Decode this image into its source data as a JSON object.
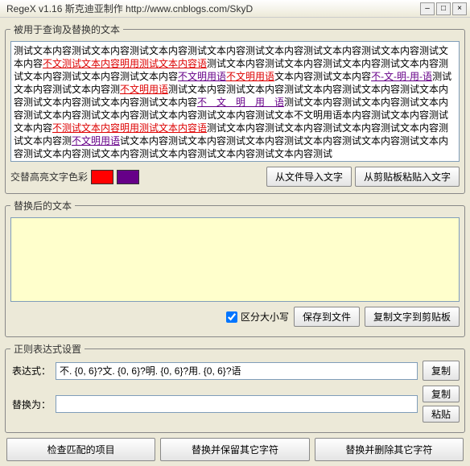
{
  "title": "RegeX v1.16  斯克迪亚制作   http://www.cnblogs.com/SkyD",
  "groups": {
    "source": "被用于查询及替换的文本",
    "replaced": "替换后的文本",
    "regex": "正则表达式设置"
  },
  "source_segments": [
    {
      "t": "测试文本内容测试文本内容测试文本内容测试文本内容测试文本内容测试文本内容测试文本内容测试文本内容",
      "c": "n"
    },
    {
      "t": "不文测试文本内容明用测试文本内容语",
      "c": "r"
    },
    {
      "t": "测试文本内容测试文本内容测试文本内容测试文本内容测试文本内容测试文本内容测试文本内容",
      "c": "n"
    },
    {
      "t": "不文明用语",
      "c": "p"
    },
    {
      "t": "不文明用语",
      "c": "r"
    },
    {
      "t": "文本内容测试文本内容",
      "c": "n"
    },
    {
      "t": "不-文-明-用-语",
      "c": "p"
    },
    {
      "t": "测试文本内容测试文本内容测",
      "c": "n"
    },
    {
      "t": "不文明用语",
      "c": "r"
    },
    {
      "t": "测试文本内容测试文本内容测试文本内容测试文本内容测试文本内容测试文本内容测试文本内容测试文本内容",
      "c": "n"
    },
    {
      "t": "不　文　明　用　语",
      "c": "p"
    },
    {
      "t": "测试文本内容测试文本内容测试文本内容测试文本内容测试文本内容测试文本内容测试文本内容测试文本不",
      "c": "n"
    },
    {
      "t": "文明用语本内容测试文本内容测试文本内容",
      "c": "n"
    },
    {
      "t": "不测试文本内容明用测试文本内容语",
      "c": "r"
    },
    {
      "t": "测试文本内容测试文本内容测试文本内容测试文本内容测试文本内容测",
      "c": "n"
    },
    {
      "t": "不文明用语",
      "c": "p"
    },
    {
      "t": "试文本内容测试文本内容测试文本内容测试文本内容测试文本内容测试文本内容测试文本内容测试文本内容测试文本内容测试文本内容测试文本内容测试",
      "c": "n"
    }
  ],
  "toolbar": {
    "swap_label": "交替高亮文字色彩",
    "import_file": "从文件导入文字",
    "paste_clip": "从剪贴板粘贴入文字"
  },
  "options": {
    "case_sensitive_label": "区分大小写",
    "case_sensitive": true,
    "save_file": "保存到文件",
    "copy_clip": "复制文字到剪贴板"
  },
  "regex": {
    "expr_label": "表达式：",
    "expr_value": "不. {0, 6}?文. {0, 6}?明. {0, 6}?用. {0, 6}?语",
    "repl_label": "替换为：",
    "repl_value": "",
    "copy_btn": "复制",
    "paste_btn": "粘贴"
  },
  "bottom": {
    "check": "检查匹配的项目",
    "replace_keep": "替换并保留其它字符",
    "replace_remove": "替换并删除其它字符"
  }
}
